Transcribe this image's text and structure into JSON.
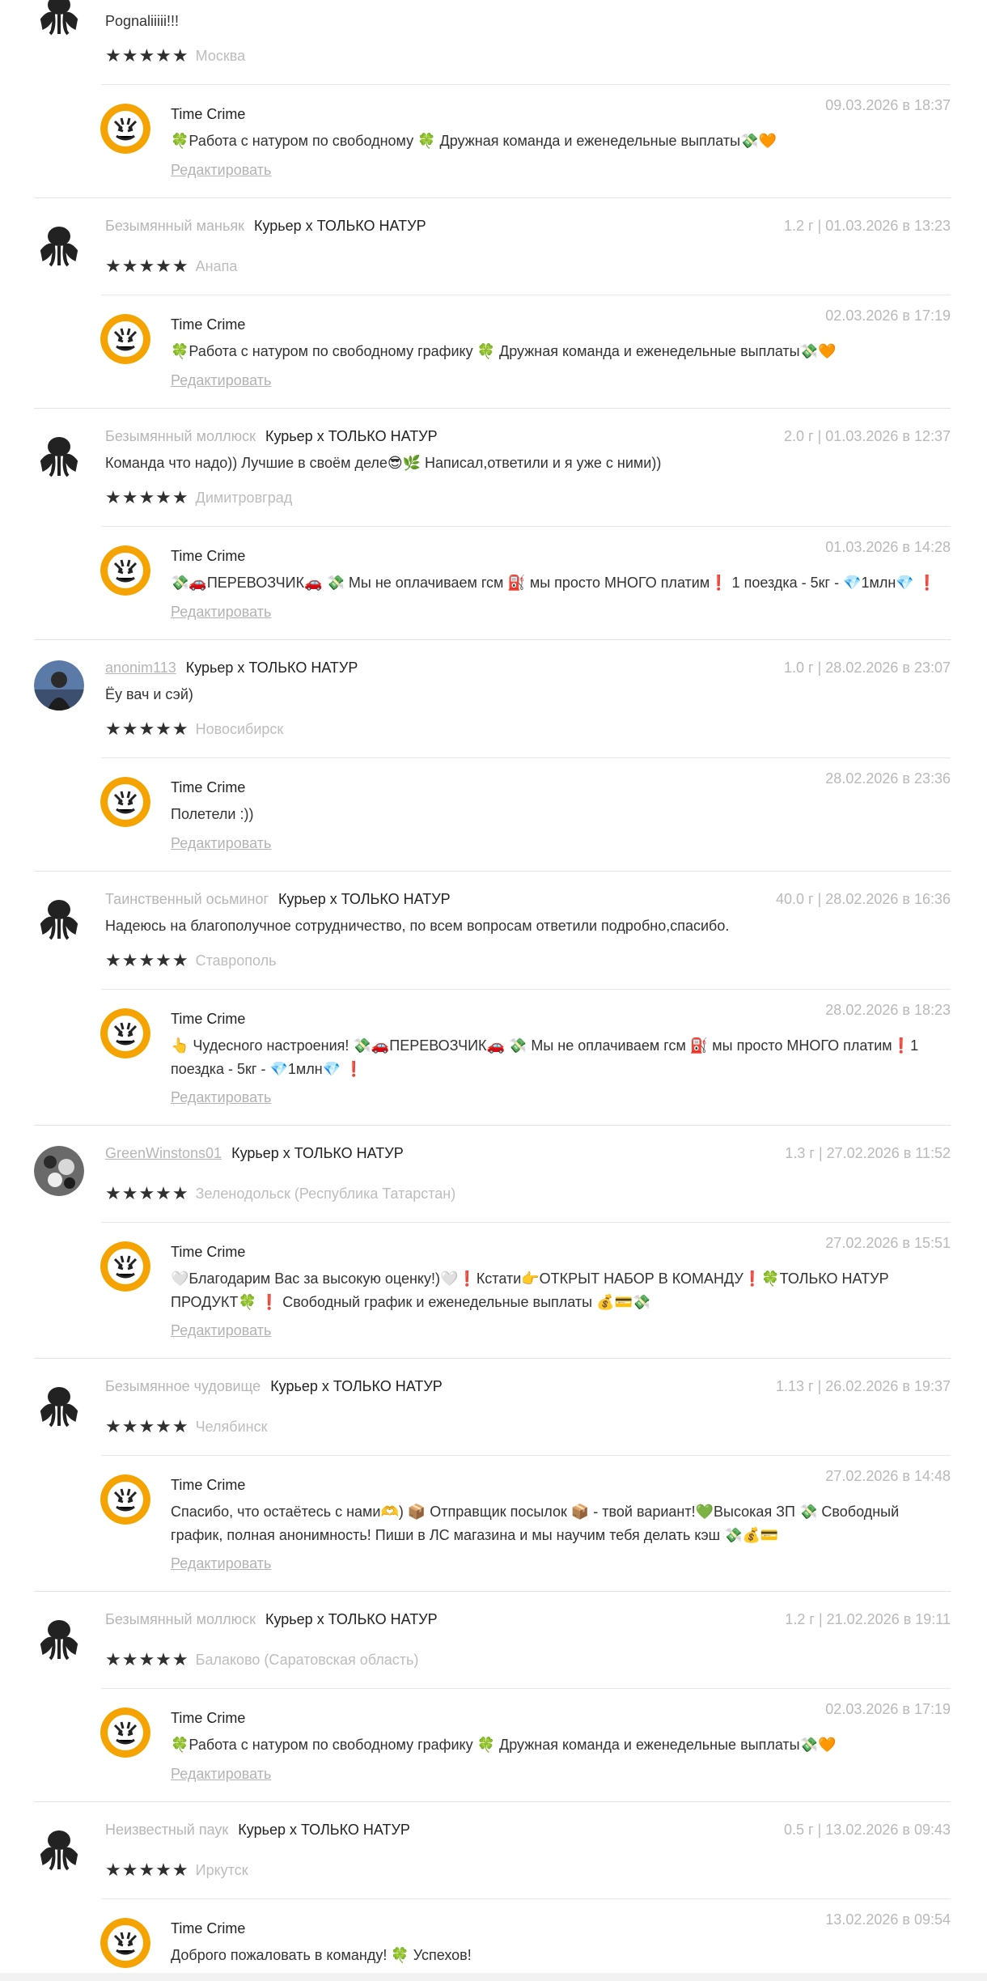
{
  "colors": {
    "muted": "#b9b9b9",
    "text": "#333333",
    "star": "#2f2f2f",
    "logo_orange": "#f4a300"
  },
  "shop": {
    "name": "Time Crime",
    "logo_icon": "tiger-logo"
  },
  "edit_label": "Редактировать",
  "reviews": [
    {
      "user": "",
      "product": "",
      "meta": "",
      "text": "Pognaliiiii!!!",
      "rating": 5,
      "city": "Москва",
      "avatar_icon": "octopus-avatar",
      "reply": {
        "date": "09.03.2026 в 18:37",
        "text": "🍀Работа с натуром по свободному 🍀 Дружная команда и еженедельные выплаты💸🧡"
      }
    },
    {
      "user": "Безымянный маньяк",
      "product": "Курьер х ТОЛЬКО НАТУР",
      "meta": "1.2 г | 01.03.2026 в 13:23",
      "text": "",
      "rating": 5,
      "city": "Анапа",
      "avatar_icon": "octopus-avatar",
      "reply": {
        "date": "02.03.2026 в 17:19",
        "text": "🍀Работа с натуром по свободному графику 🍀 Дружная команда и еженедельные выплаты💸🧡"
      }
    },
    {
      "user": "Безымянный моллюск",
      "product": "Курьер х ТОЛЬКО НАТУР",
      "meta": "2.0 г | 01.03.2026 в 12:37",
      "text": "Команда что надо)) Лучшие в своём деле😎🌿 Написал,ответили и я уже с ними))",
      "rating": 5,
      "city": "Димитровград",
      "avatar_icon": "octopus-avatar",
      "reply": {
        "date": "01.03.2026 в 14:28",
        "text": "💸🚗ПЕРЕВОЗЧИК🚗 💸 Мы не оплачиваем гсм ⛽ мы просто МНОГО платим❗ 1 поездка - 5кг - 💎1млн💎 ❗"
      }
    },
    {
      "user": "anonim113",
      "product": "Курьер х ТОЛЬКО НАТУР",
      "meta": "1.0 г | 28.02.2026 в 23:07",
      "text": "Ёу вач и сэй)",
      "rating": 5,
      "city": "Новосибирск",
      "avatar_icon": "photo-avatar",
      "reply": {
        "date": "28.02.2026 в 23:36",
        "text": "Полетели :))"
      }
    },
    {
      "user": "Таинственный осьминог",
      "product": "Курьер х ТОЛЬКО НАТУР",
      "meta": "40.0 г | 28.02.2026 в 16:36",
      "text": "Надеюсь на благополучное сотрудничество, по всем вопросам ответили подробно,спасибо.",
      "rating": 5,
      "city": "Ставрополь",
      "avatar_icon": "octopus-avatar",
      "reply": {
        "date": "28.02.2026 в 18:23",
        "text": "👆 Чудесного настроения! 💸🚗ПЕРЕВОЗЧИК🚗 💸 Мы не оплачиваем гсм ⛽ мы просто МНОГО платим❗1 поездка - 5кг - 💎1млн💎 ❗"
      }
    },
    {
      "user": "GreenWinstons01",
      "product": "Курьер х ТОЛЬКО НАТУР",
      "meta": "1.3 г | 27.02.2026 в 11:52",
      "text": "",
      "rating": 5,
      "city": "Зеленодольск (Республика Татарстан)",
      "avatar_icon": "photo-avatar",
      "reply": {
        "date": "27.02.2026 в 15:51",
        "text": "🤍Благодарим Вас за высокую оценку!)🤍❗Кстати👉ОТКРЫТ НАБОР В КОМАНДУ❗🍀ТОЛЬКО НАТУР ПРОДУКТ🍀 ❗ Свободный график и еженедельные выплаты 💰💳💸"
      }
    },
    {
      "user": "Безымянное чудовище",
      "product": "Курьер х ТОЛЬКО НАТУР",
      "meta": "1.13 г | 26.02.2026 в 19:37",
      "text": "",
      "rating": 5,
      "city": "Челябинск",
      "avatar_icon": "octopus-avatar",
      "reply": {
        "date": "27.02.2026 в 14:48",
        "text": "Спасибо, что остаётесь с нами🫶) 📦 Отправщик посылок 📦 - твой вариант!💚Высокая ЗП 💸 Свободный график, полная анонимность! Пиши в ЛС магазина и мы научим тебя делать кэш 💸💰💳"
      }
    },
    {
      "user": "Безымянный моллюск",
      "product": "Курьер х ТОЛЬКО НАТУР",
      "meta": "1.2 г | 21.02.2026 в 19:11",
      "text": "",
      "rating": 5,
      "city": "Балаково (Саратовская область)",
      "avatar_icon": "octopus-avatar",
      "reply": {
        "date": "02.03.2026 в 17:19",
        "text": "🍀Работа с натуром по свободному графику 🍀 Дружная команда и еженедельные выплаты💸🧡"
      }
    },
    {
      "user": "Неизвестный паук",
      "product": "Курьер х ТОЛЬКО НАТУР",
      "meta": "0.5 г | 13.02.2026 в 09:43",
      "text": "",
      "rating": 5,
      "city": "Иркутск",
      "avatar_icon": "octopus-avatar",
      "reply": {
        "date": "13.02.2026 в 09:54",
        "text": "Доброго пожаловать в команду! 🍀 Успехов!"
      }
    }
  ]
}
